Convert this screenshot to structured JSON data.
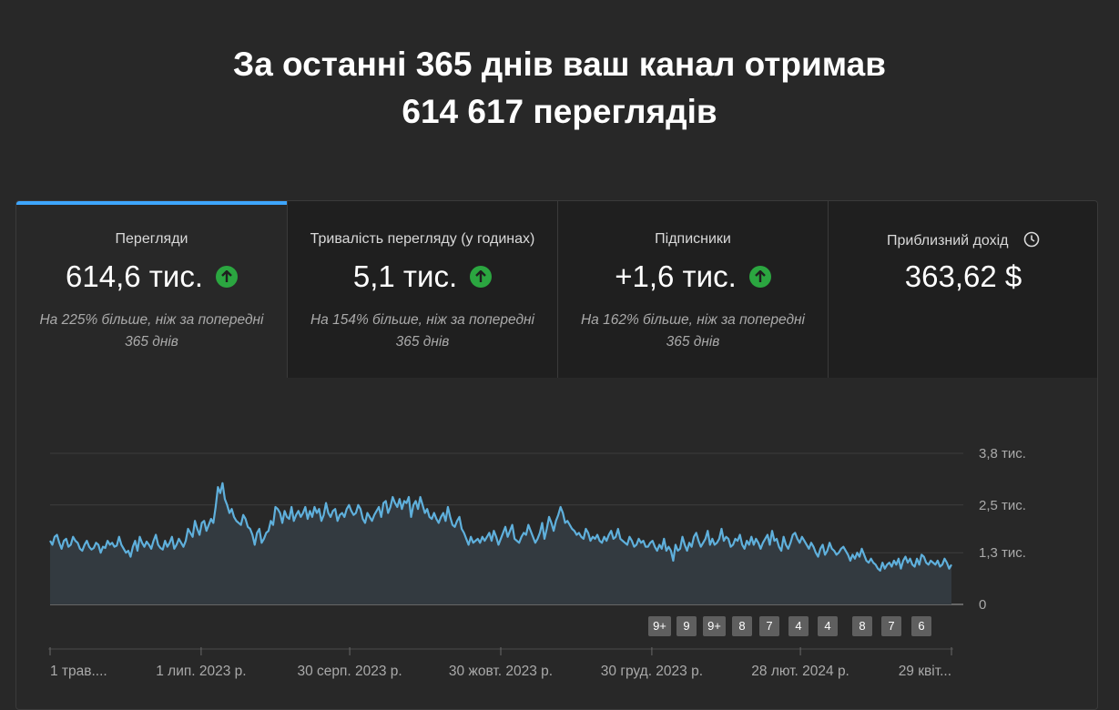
{
  "headline": {
    "line1": "За останні 365 днів ваш канал отримав",
    "line2": "614 617 переглядів"
  },
  "metrics": [
    {
      "title": "Перегляди",
      "value": "614,6 тис.",
      "trend": "up",
      "note_line1": "На 225% більше, ніж за попередні",
      "note_line2": "365 днів",
      "active": true
    },
    {
      "title": "Тривалість перегляду (у годинах)",
      "value": "5,1 тис.",
      "trend": "up",
      "note_line1": "На 154% більше, ніж за попередні",
      "note_line2": "365 днів",
      "active": false
    },
    {
      "title": "Підписники",
      "value": "+1,6 тис.",
      "trend": "up",
      "note_line1": "На 162% більше, ніж за попередні",
      "note_line2": "365 днів",
      "active": false
    },
    {
      "title": "Приблизний дохід",
      "value": "363,62 $",
      "trend": "none",
      "icon": "clock-icon",
      "active": false
    }
  ],
  "colors": {
    "accent": "#3ea6ff",
    "line": "#5fb0dc",
    "up": "#2ba640",
    "background": "#282828"
  },
  "badges": [
    "9+",
    "9",
    "9+",
    "8",
    "7",
    "4",
    "4",
    "8",
    "7",
    "6"
  ],
  "chart_data": {
    "type": "area",
    "title": "",
    "xlabel": "",
    "ylabel": "",
    "y_ticks": [
      "3,8 тис.",
      "2,5 тис.",
      "1,3 тис.",
      "0"
    ],
    "y_tick_values": [
      3800,
      2500,
      1300,
      0
    ],
    "ylim": [
      0,
      3800
    ],
    "x_ticks": [
      "1 трав....",
      "1 лип. 2023 р.",
      "30 серп. 2023 р.",
      "30 жовт. 2023 р.",
      "30 груд. 2023 р.",
      "28 лют. 2024 р.",
      "29 квіт..."
    ],
    "x_tick_days": [
      0,
      61,
      121,
      182,
      243,
      303,
      364
    ],
    "series": [
      {
        "values": [
          1600,
          1500,
          1700,
          1750,
          1550,
          1400,
          1600,
          1650,
          1450,
          1500,
          1700,
          1600,
          1550,
          1400,
          1350,
          1500,
          1600,
          1450,
          1380,
          1420,
          1550,
          1500,
          1300,
          1450,
          1420,
          1600,
          1500,
          1550,
          1450,
          1480,
          1700,
          1500,
          1400,
          1300,
          1350,
          1200,
          1450,
          1600,
          1350,
          1700,
          1550,
          1450,
          1580,
          1500,
          1400,
          1600,
          1750,
          1500,
          1420,
          1380,
          1600,
          1450,
          1550,
          1700,
          1400,
          1500,
          1650,
          1550,
          1450,
          1600,
          1900,
          1800,
          1700,
          2100,
          1900,
          1750,
          2050,
          2100,
          1850,
          2000,
          2150,
          2050,
          2450,
          2950,
          2800,
          3050,
          2650,
          2500,
          2300,
          2400,
          2200,
          2100,
          2050,
          2000,
          2250,
          2150,
          1950,
          1900,
          1750,
          1500,
          1800,
          1900,
          1550,
          1650,
          1800,
          1850,
          2100,
          2000,
          2450,
          2400,
          2300,
          2050,
          2350,
          2200,
          2150,
          2450,
          2100,
          2250,
          2350,
          2200,
          2300,
          2450,
          2150,
          2350,
          2200,
          2450,
          2300,
          2400,
          2100,
          2250,
          2550,
          2300,
          2200,
          2350,
          2400,
          2100,
          2250,
          2300,
          2200,
          2400,
          2500,
          2350,
          2250,
          2300,
          2500,
          2400,
          2150,
          2050,
          2300,
          2200,
          2100,
          2250,
          2350,
          2450,
          2200,
          2550,
          2600,
          2300,
          2450,
          2700,
          2550,
          2450,
          2650,
          2400,
          2600,
          2550,
          2700,
          2200,
          2500,
          2600,
          2400,
          2700,
          2500,
          2300,
          2400,
          2200,
          2150,
          2300,
          2150,
          2050,
          2200,
          2300,
          2100,
          2450,
          2200,
          2000,
          1950,
          2100,
          2200,
          1900,
          1800,
          1650,
          1500,
          1700,
          1550,
          1600,
          1650,
          1550,
          1700,
          1600,
          1700,
          1800,
          1600,
          1850,
          1700,
          1500,
          1650,
          1800,
          1950,
          1700,
          1850,
          2000,
          1650,
          1600,
          1550,
          1700,
          1800,
          1750,
          2000,
          1850,
          1700,
          1550,
          1650,
          1800,
          2050,
          1650,
          1900,
          2200,
          2050,
          1850,
          2100,
          2250,
          2450,
          2300,
          2050,
          2100,
          2000,
          1900,
          1850,
          1750,
          1800,
          1700,
          1650,
          1900,
          1800,
          1600,
          1700,
          1650,
          1750,
          1600,
          1550,
          1700,
          1600,
          1750,
          1850,
          1650,
          1700,
          1900,
          1650,
          1600,
          1550,
          1500,
          1700,
          1600,
          1450,
          1500,
          1650,
          1550,
          1600,
          1450,
          1450,
          1550,
          1600,
          1450,
          1350,
          1500,
          1400,
          1650,
          1350,
          1450,
          1350,
          1100,
          1500,
          1350,
          1400,
          1700,
          1500,
          1350,
          1550,
          1450,
          1700,
          1800,
          1600,
          1450,
          1550,
          1650,
          1850,
          1500,
          1650,
          1500,
          1550,
          1650,
          1900,
          1600,
          1700,
          1650,
          1450,
          1500,
          1650,
          1600,
          1750,
          1500,
          1400,
          1600,
          1500,
          1700,
          1500,
          1650,
          1550,
          1400,
          1550,
          1650,
          1750,
          1500,
          1850,
          1600,
          1650,
          1450,
          1350,
          1700,
          1500,
          1400,
          1550,
          1750,
          1800,
          1650,
          1550,
          1700,
          1600,
          1500,
          1400,
          1550,
          1450,
          1300,
          1200,
          1400,
          1500,
          1250,
          1350,
          1550,
          1400,
          1350,
          1250,
          1300,
          1400,
          1450,
          1350,
          1250,
          1100,
          1250,
          1150,
          1300,
          1200,
          1400,
          1250,
          1100,
          1050,
          1150,
          1050,
          1000,
          900,
          850,
          1050,
          900,
          1000,
          1050,
          950,
          1100,
          1000,
          1150,
          900,
          1100,
          1200,
          1050,
          1150,
          1000,
          950,
          1150,
          1000,
          1250,
          1200,
          1050,
          1000,
          1100,
          1050,
          1000,
          1100,
          950,
          1000,
          1150,
          1050,
          900,
          1000
        ]
      }
    ],
    "grid": true
  }
}
